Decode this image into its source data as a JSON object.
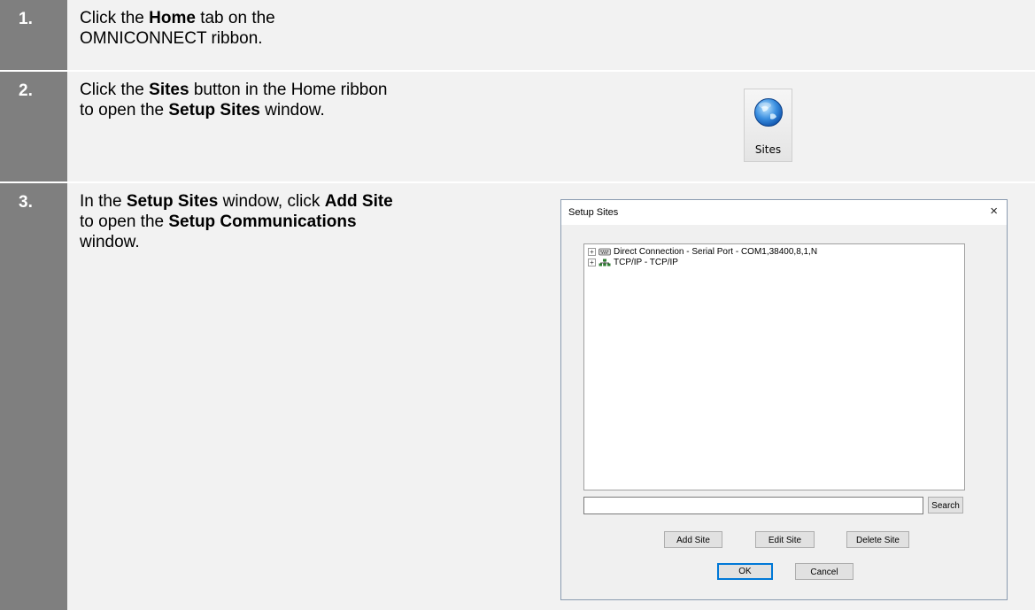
{
  "steps": [
    {
      "number": "1.",
      "line1_pre": "Click the ",
      "line1_bold": "Home",
      "line1_post": " tab on the",
      "line2": "OMNICONNECT ribbon."
    },
    {
      "number": "2.",
      "line1_pre": "Click the ",
      "line1_bold": "Sites",
      "line1_post": " button in the Home ribbon",
      "line2_pre": "to open the ",
      "line2_bold": "Setup Sites",
      "line2_post": " window."
    },
    {
      "number": "3.",
      "line1_pre": "In the ",
      "line1_bold": "Setup Sites",
      "line1_mid": " window, click ",
      "line1_bold2": "Add Site",
      "line2_pre": "to open the ",
      "line2_bold": "Setup Communications",
      "line3": "window."
    }
  ],
  "sites_button": {
    "label": "Sites",
    "icon": "globe-icon"
  },
  "setup_sites_window": {
    "title": "Setup Sites",
    "close_glyph": "×",
    "tree_items": [
      {
        "expander": "+",
        "icon": "serial-port-icon",
        "label": "Direct Connection - Serial Port - COM1,38400,8,1,N"
      },
      {
        "expander": "+",
        "icon": "network-icon",
        "label": "TCP/IP - TCP/IP"
      }
    ],
    "search_value": "",
    "search_button": "Search",
    "add_site": "Add Site",
    "edit_site": "Edit Site",
    "delete_site": "Delete Site",
    "ok": "OK",
    "cancel": "Cancel"
  },
  "colors": {
    "number_bar": "#7f7f7f",
    "row_background": "#f2f2f2",
    "focus_border": "#0078d7"
  }
}
